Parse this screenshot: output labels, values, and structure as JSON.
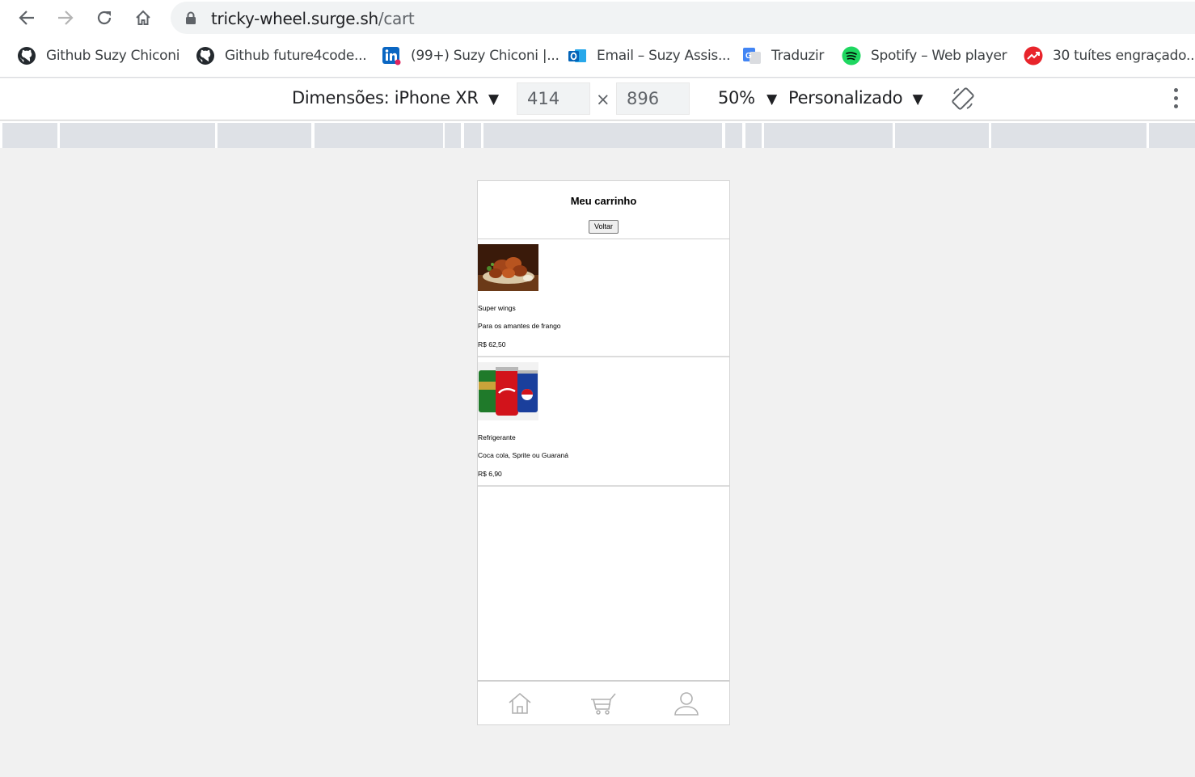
{
  "browser": {
    "url_host": "tricky-wheel.surge.sh",
    "url_path": "/cart",
    "bookmarks": [
      {
        "label": "Github Suzy Chiconi",
        "icon": "github-icon"
      },
      {
        "label": "Github future4code...",
        "icon": "github-icon"
      },
      {
        "label": "(99+) Suzy Chiconi |...",
        "icon": "linkedin-icon"
      },
      {
        "label": "Email – Suzy Assis...",
        "icon": "outlook-icon"
      },
      {
        "label": "Traduzir",
        "icon": "google-translate-icon"
      },
      {
        "label": "Spotify – Web player",
        "icon": "spotify-icon"
      },
      {
        "label": "30 tuítes engraçado...",
        "icon": "trending-icon"
      }
    ]
  },
  "device_toolbar": {
    "dimensions_label": "Dimensões: iPhone XR",
    "width": "414",
    "times": "×",
    "height": "896",
    "zoom": "50%",
    "throttle": "Personalizado"
  },
  "app": {
    "title": "Meu carrinho",
    "back_label": "Voltar",
    "items": [
      {
        "name": "Super wings",
        "description": "Para os amantes de frango",
        "price": "R$ 62,50",
        "image": "chicken-wings-photo"
      },
      {
        "name": "Refrigerante",
        "description": "Coca cola, Sprite ou Guaraná",
        "price": "R$ 6,90",
        "image": "soda-cans-photo"
      }
    ],
    "nav": [
      "home-icon",
      "cart-icon",
      "profile-icon"
    ]
  },
  "colors": {
    "accent_inactive": "#b0b0b0",
    "wings_bg": "#5a2d12",
    "coke": "#d2131b",
    "pepsi": "#1a3f9c",
    "guarana": "#1f7a2a"
  }
}
